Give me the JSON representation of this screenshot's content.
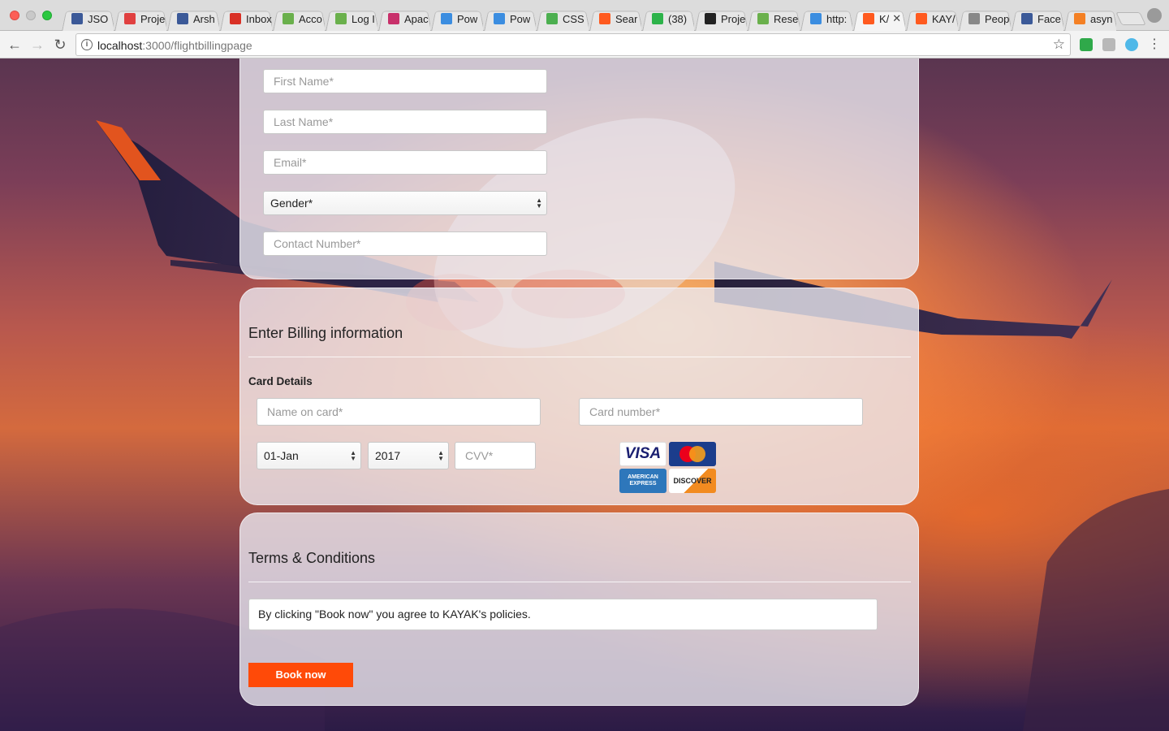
{
  "browser": {
    "tabs": [
      {
        "label": "JSO",
        "favicon_color": "#3b5998",
        "icon": "json-icon"
      },
      {
        "label": "Proje",
        "favicon_color": "#e04040",
        "icon": "project-icon"
      },
      {
        "label": "Arsh",
        "favicon_color": "#3b5998",
        "icon": "facebook-icon"
      },
      {
        "label": "Inbox",
        "favicon_color": "#d93025",
        "icon": "gmail-icon"
      },
      {
        "label": "Acco",
        "favicon_color": "#6ab04c",
        "icon": "leaf-icon"
      },
      {
        "label": "Log I",
        "favicon_color": "#6ab04c",
        "icon": "leaf-icon"
      },
      {
        "label": "Apac",
        "favicon_color": "#c8306a",
        "icon": "feather-icon"
      },
      {
        "label": "Pow",
        "favicon_color": "#3b8de0",
        "icon": "powerpoint-icon"
      },
      {
        "label": "Pow",
        "favicon_color": "#3b8de0",
        "icon": "powerpoint-icon"
      },
      {
        "label": "CSS",
        "favicon_color": "#4caf50",
        "icon": "css-icon"
      },
      {
        "label": "Sear",
        "favicon_color": "#ff5a1f",
        "icon": "kayak-icon"
      },
      {
        "label": "(38)",
        "favicon_color": "#2db34a",
        "icon": "whatsapp-icon"
      },
      {
        "label": "Proje",
        "favicon_color": "#222222",
        "icon": "github-icon"
      },
      {
        "label": "Rese",
        "favicon_color": "#6ab04c",
        "icon": "leaf-icon"
      },
      {
        "label": "http:",
        "favicon_color": "#3b8de0",
        "icon": "powerpoint-icon"
      },
      {
        "label": "K/",
        "favicon_color": "#ff5a1f",
        "icon": "kayak-icon",
        "active": true
      },
      {
        "label": "KAY/",
        "favicon_color": "#ff5a1f",
        "icon": "kayak-icon"
      },
      {
        "label": "Peop",
        "favicon_color": "#888888",
        "icon": "document-icon"
      },
      {
        "label": "Face",
        "favicon_color": "#3b5998",
        "icon": "facebook-icon"
      },
      {
        "label": "asyn",
        "favicon_color": "#f48024",
        "icon": "stackoverflow-icon"
      }
    ],
    "url_host": "localhost",
    "url_path": ":3000/flightbillingpage"
  },
  "traveler": {
    "first_name_placeholder": "First Name*",
    "last_name_placeholder": "Last Name*",
    "email_placeholder": "Email*",
    "gender_selected": "Gender*",
    "contact_placeholder": "Contact Number*"
  },
  "billing": {
    "title": "Enter Billing information",
    "card_details_label": "Card Details",
    "name_on_card_placeholder": "Name on card*",
    "card_number_placeholder": "Card number*",
    "expiry_day_selected": "01-Jan",
    "expiry_year_selected": "2017",
    "cvv_placeholder": "CVV*",
    "card_logos": {
      "visa": "VISA",
      "mastercard": "MasterCard",
      "amex": "AMERICAN EXPRESS",
      "discover": "DISCOVER"
    }
  },
  "terms": {
    "title": "Terms & Conditions",
    "text": "By clicking \"Book now\" you agree to KAYAK's policies.",
    "book_button": "Book now"
  },
  "colors": {
    "accent": "#ff4a08",
    "kayak": "#ff5a1f"
  }
}
